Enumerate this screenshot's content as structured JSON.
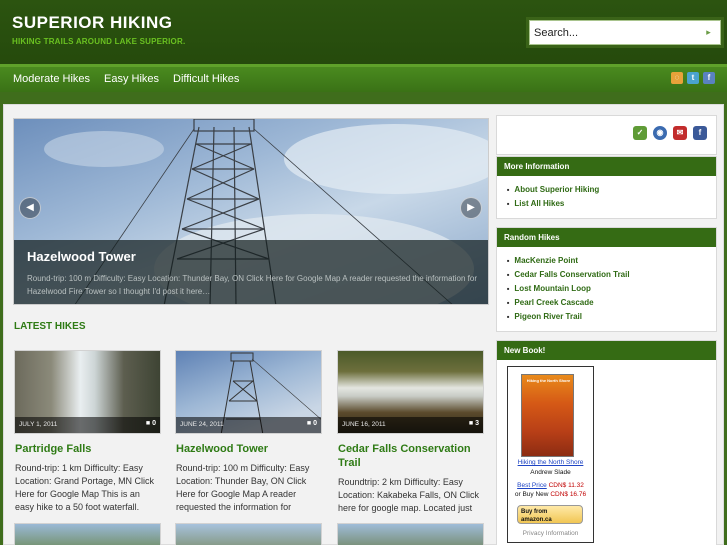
{
  "site": {
    "title": "SUPERIOR HIKING",
    "tagline": "HIKING TRAILS AROUND LAKE SUPERIOR."
  },
  "search": {
    "placeholder": "Search..."
  },
  "nav": {
    "items": [
      "Moderate Hikes",
      "Easy Hikes",
      "Difficult Hikes"
    ],
    "social_icons": [
      "rss-icon",
      "twitter-icon",
      "facebook-icon"
    ]
  },
  "slider": {
    "title": "Hazelwood Tower",
    "excerpt": "Round-trip: 100 m Difficulty: Easy Location: Thunder Bay, ON Click Here for Google Map A reader requested the information for Hazelwood Fire Tower so I thought I'd post it here…",
    "prev_icon": "chevron-left-icon",
    "next_icon": "chevron-right-icon"
  },
  "latest": {
    "heading": "LATEST HIKES",
    "posts": [
      {
        "date": "JULY 1, 2011",
        "comments": "0",
        "title": "Partridge Falls",
        "excerpt": "Round-trip: 1 km Difficulty: Easy Location: Grand Portage, MN Click Here for Google Map This is an easy hike to a 50 foot waterfall."
      },
      {
        "date": "JUNE 24, 2011",
        "comments": "0",
        "title": "Hazelwood Tower",
        "excerpt": "Round-trip: 100 m Difficulty: Easy Location: Thunder Bay, ON Click Here for Google Map A reader requested the information for"
      },
      {
        "date": "JUNE 16, 2011",
        "comments": "3",
        "title": "Cedar Falls Conservation Trail",
        "excerpt": "Roundtrip: 2 km Difficulty: Easy Location: Kakabeka Falls, ON Click here for google map. Located just"
      }
    ]
  },
  "sidebar": {
    "social_icons": [
      "share-icon",
      "globe-icon",
      "email-icon",
      "facebook-icon"
    ],
    "more_info": {
      "title": "More Information",
      "items": [
        "About Superior Hiking",
        "List All Hikes"
      ]
    },
    "random_hikes": {
      "title": "Random Hikes",
      "items": [
        "MacKenzie Point",
        "Cedar Falls Conservation Trail",
        "Lost Mountain Loop",
        "Pearl Creek Cascade",
        "Pigeon River Trail"
      ]
    },
    "new_book": {
      "title": "New Book!",
      "cover_title": "Hiking the North Shore",
      "link": "Hiking the North Shore",
      "author": "Andrew Slade",
      "best_price_label": "Best Price",
      "best_price": "CDN$ 11.32",
      "or_buy_new_label": "or Buy New",
      "new_price": "CDN$ 16.76",
      "amazon_button": "Buy from amazon.ca",
      "privacy": "Privacy Information"
    }
  },
  "colors": {
    "header_bg": "#2c5410",
    "nav_bg": "#4a8a1f",
    "accent_green": "#2f7b15",
    "widget_title_bg": "#356b14",
    "price_red": "#c00000"
  }
}
